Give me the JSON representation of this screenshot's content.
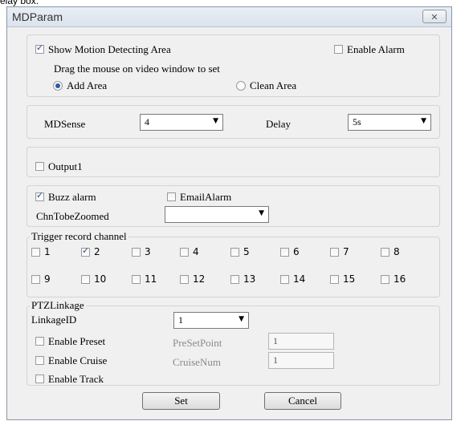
{
  "cut_text": "elay box.",
  "window": {
    "title": "MDParam",
    "close_glyph": "✕"
  },
  "motion": {
    "show_label": "Show Motion Detecting Area",
    "show_checked": true,
    "enable_alarm_label": "Enable Alarm",
    "enable_alarm_checked": false,
    "hint": "Drag the mouse on video window to set",
    "add_area_label": "Add Area",
    "add_area_selected": true,
    "clean_area_label": "Clean Area",
    "clean_area_selected": false
  },
  "sense": {
    "mdsense_label": "MDSense",
    "mdsense_value": "4",
    "delay_label": "Delay",
    "delay_value": "5s",
    "arrow": "▼"
  },
  "output": {
    "output1_label": "Output1",
    "output1_checked": false
  },
  "alarm": {
    "buzz_label": "Buzz alarm",
    "buzz_checked": true,
    "email_label": "EmailAlarm",
    "email_checked": false,
    "zoom_label": "ChnTobeZoomed",
    "zoom_value": ""
  },
  "trigger": {
    "title": "Trigger record channel",
    "channels": [
      "1",
      "2",
      "3",
      "4",
      "5",
      "6",
      "7",
      "8",
      "9",
      "10",
      "11",
      "12",
      "13",
      "14",
      "15",
      "16"
    ],
    "checked": [
      false,
      true,
      false,
      false,
      false,
      false,
      false,
      false,
      false,
      false,
      false,
      false,
      false,
      false,
      false,
      false
    ]
  },
  "ptz": {
    "title": "PTZLinkage",
    "linkage_label": "LinkageID",
    "linkage_value": "1",
    "preset_label": "Enable Preset",
    "preset_checked": false,
    "preset_point_label": "PreSetPoint",
    "preset_point_value": "1",
    "cruise_label": "Enable Cruise",
    "cruise_checked": false,
    "cruise_num_label": "CruiseNum",
    "cruise_num_value": "1",
    "track_label": "Enable Track",
    "track_checked": false
  },
  "buttons": {
    "set": "Set",
    "cancel": "Cancel"
  }
}
